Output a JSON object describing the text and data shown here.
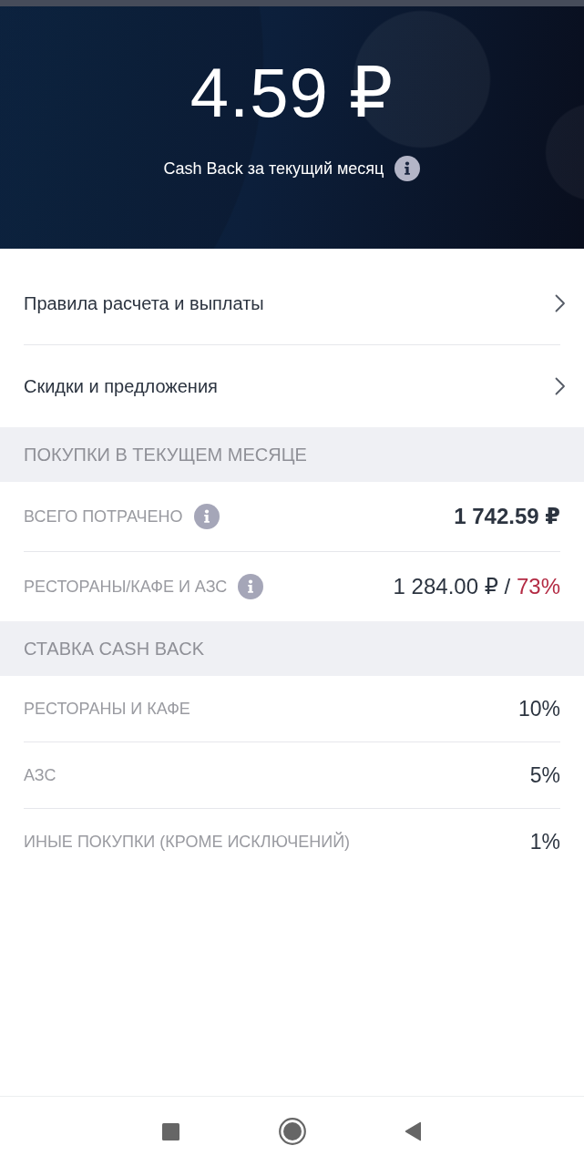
{
  "header": {
    "amount": "4.59 ₽",
    "caption": "Cash Back за текущий месяц"
  },
  "menu": [
    {
      "label": "Правила расчета и выплаты"
    },
    {
      "label": "Скидки и предложения"
    }
  ],
  "sections": [
    {
      "title": "ПОКУПКИ В ТЕКУЩЕМ МЕСЯЦЕ",
      "rows": [
        {
          "kind": "total",
          "label": "ВСЕГО ПОТРАЧЕНО",
          "info": true,
          "value": "1 742.59 ₽"
        },
        {
          "kind": "split",
          "label": "РЕСТОРАНЫ/КАФЕ И АЗС",
          "info": true,
          "value": "1 284.00 ₽ /",
          "highlight": "73%"
        }
      ]
    },
    {
      "title": "СТАВКА CASH BACK",
      "rows": [
        {
          "kind": "rate",
          "label": "РЕСТОРАНЫ И КАФЕ",
          "info": false,
          "value": "10%"
        },
        {
          "kind": "rate",
          "label": "АЗС",
          "info": false,
          "value": "5%"
        },
        {
          "kind": "rate",
          "label": "ИНЫЕ ПОКУПКИ (КРОМЕ ИСКЛЮЧЕНИЙ)",
          "info": false,
          "value": "1%"
        }
      ]
    }
  ]
}
